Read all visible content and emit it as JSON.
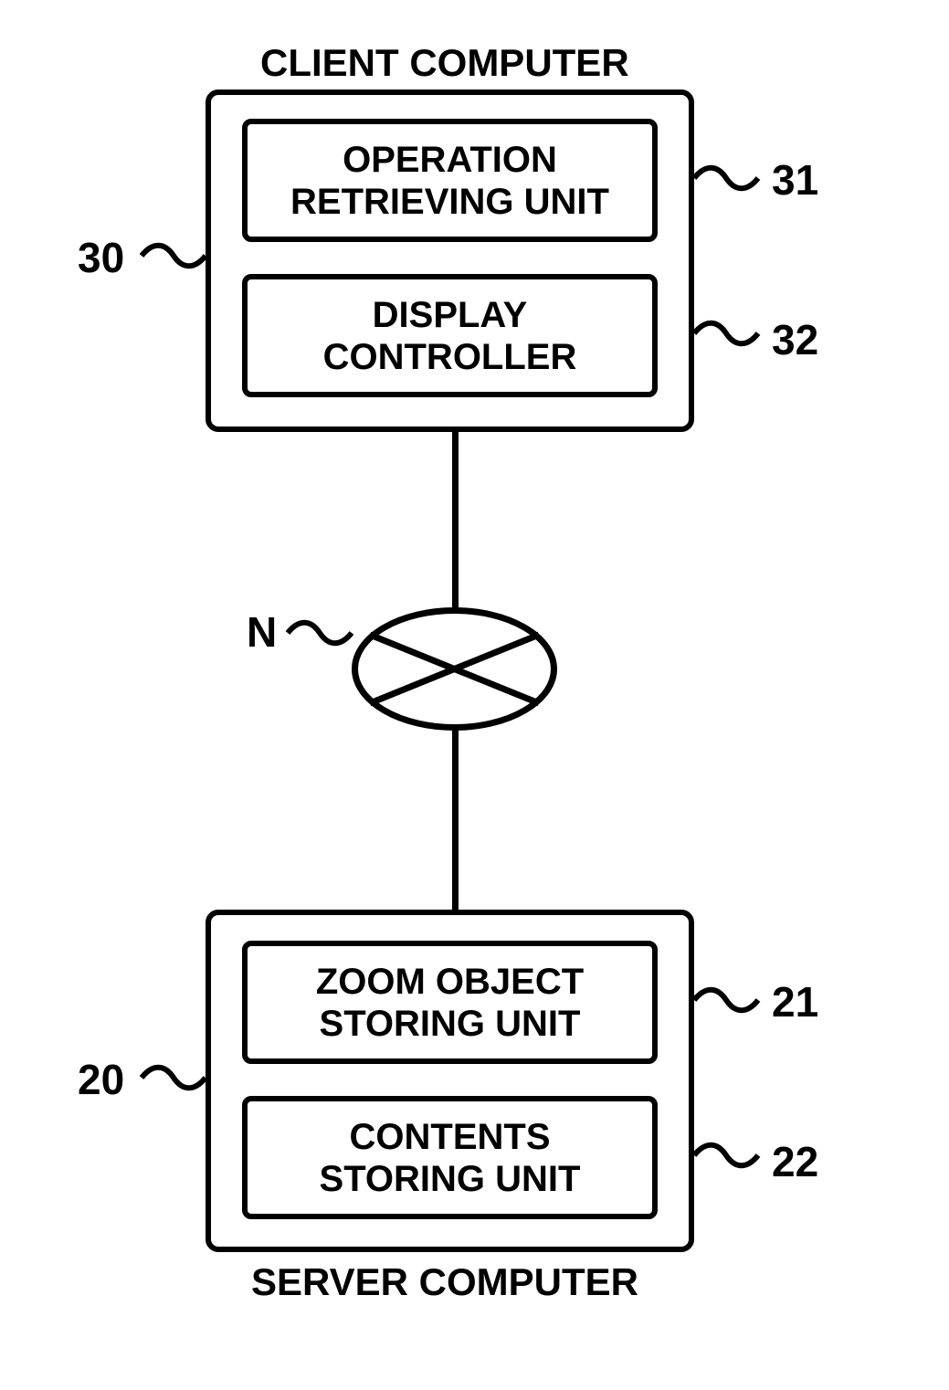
{
  "diagram": {
    "client": {
      "title": "CLIENT COMPUTER",
      "ref": "30",
      "blocks": {
        "operation_retrieving": {
          "label": "OPERATION\nRETRIEVING  UNIT",
          "ref": "31"
        },
        "display_controller": {
          "label": "DISPLAY\nCONTROLLER",
          "ref": "32"
        }
      }
    },
    "network": {
      "ref": "N"
    },
    "server": {
      "title": "SERVER COMPUTER",
      "ref": "20",
      "blocks": {
        "zoom_object_storing": {
          "label": "ZOOM OBJECT\nSTORING UNIT",
          "ref": "21"
        },
        "contents_storing": {
          "label": "CONTENTS\nSTORING UNIT",
          "ref": "22"
        }
      }
    }
  }
}
